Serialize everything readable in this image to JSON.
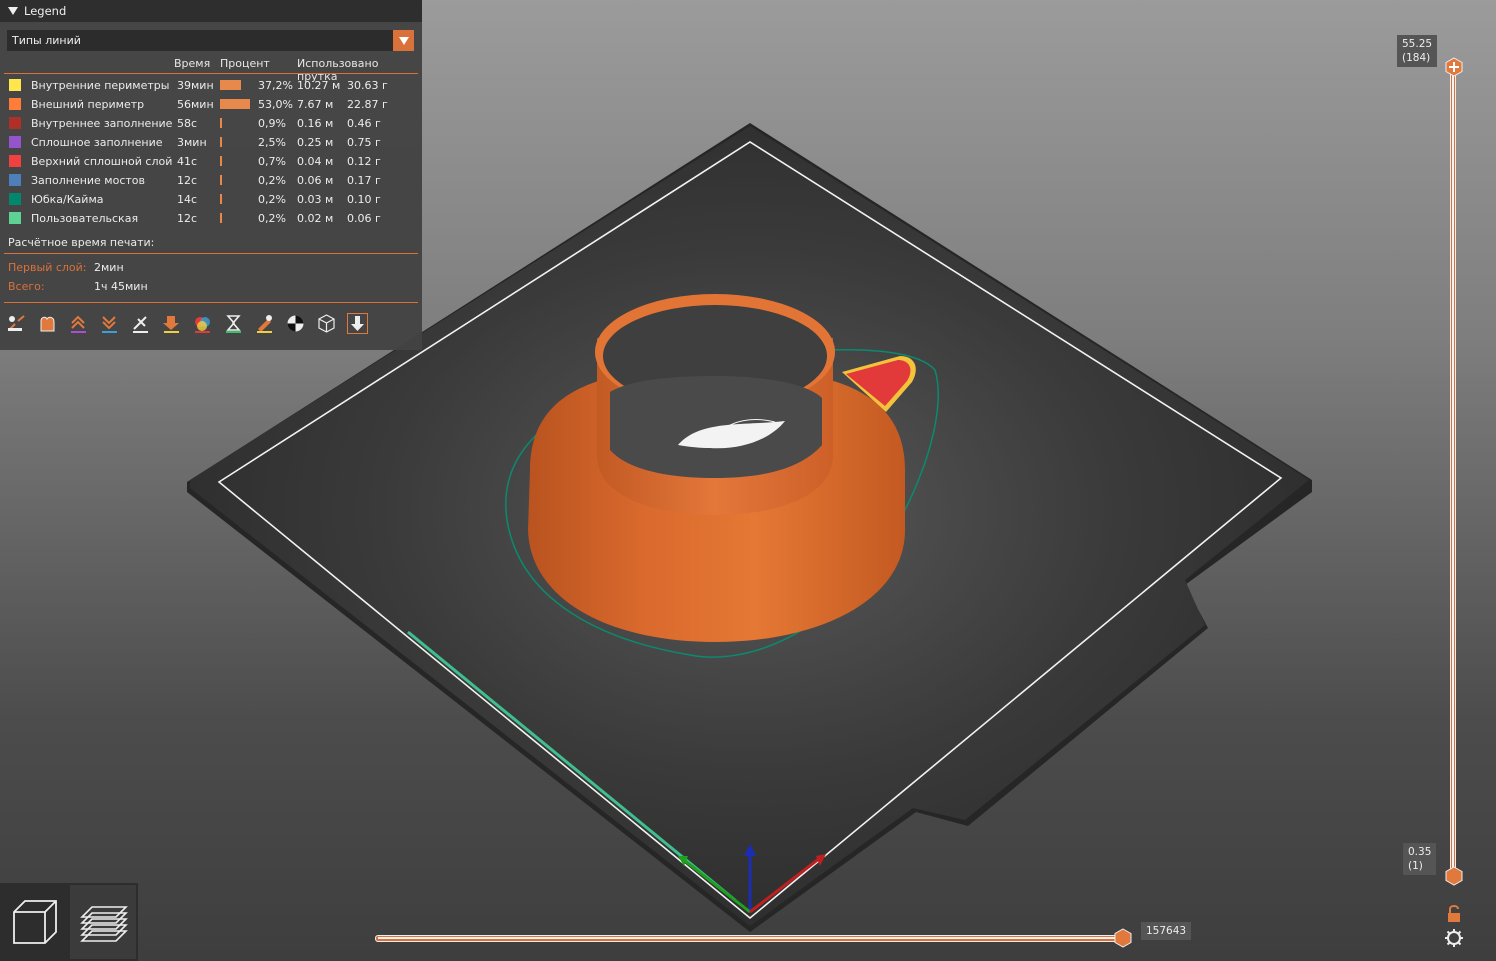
{
  "legend": {
    "title": "Legend",
    "view_type": "Типы линий",
    "columns": [
      "Время",
      "Процент",
      "Использовано прутка"
    ],
    "rows": [
      {
        "name": "Внутренние периметры",
        "color": "#ffe64d",
        "time": "39мин",
        "percent": "37,2%",
        "percent_value": 37.2,
        "length": "10.27 м",
        "weight": "30.63 г"
      },
      {
        "name": "Внешний периметр",
        "color": "#ff7d38",
        "time": "56мин",
        "percent": "53,0%",
        "percent_value": 53.0,
        "length": "7.67 м",
        "weight": "22.87 г"
      },
      {
        "name": "Внутреннее заполнение",
        "color": "#b03029",
        "time": "58с",
        "percent": "0,9%",
        "percent_value": 0.9,
        "length": "0.16 м",
        "weight": "0.46 г"
      },
      {
        "name": "Сплошное заполнение",
        "color": "#9654cc",
        "time": "3мин",
        "percent": "2,5%",
        "percent_value": 2.5,
        "length": "0.25 м",
        "weight": "0.75 г"
      },
      {
        "name": "Верхний сплошной слой",
        "color": "#f04040",
        "time": "41с",
        "percent": "0,7%",
        "percent_value": 0.7,
        "length": "0.04 м",
        "weight": "0.12 г"
      },
      {
        "name": "Заполнение мостов",
        "color": "#4d80ba",
        "time": "12с",
        "percent": "0,2%",
        "percent_value": 0.2,
        "length": "0.06 м",
        "weight": "0.17 г"
      },
      {
        "name": "Юбка/Кайма",
        "color": "#00876e",
        "time": "14с",
        "percent": "0,2%",
        "percent_value": 0.2,
        "length": "0.03 м",
        "weight": "0.10 г"
      },
      {
        "name": "Пользовательская",
        "color": "#5ed194",
        "time": "12с",
        "percent": "0,2%",
        "percent_value": 0.2,
        "length": "0.02 м",
        "weight": "0.06 г"
      }
    ],
    "estimated_time_label": "Расчётное время печати:",
    "first_layer_label": "Первый слой:",
    "first_layer_value": "2мин",
    "total_label": "Всего:",
    "total_value": "1ч 45мин",
    "toolbar_icons": [
      "travel-icon",
      "wipe-icon",
      "retractions-icon",
      "deretractions-icon",
      "seams-icon",
      "tool-changes-icon",
      "color-changes-icon",
      "pause-icon",
      "custom-gcode-icon",
      "center-of-gravity-icon",
      "shells-icon",
      "tool-marker-icon"
    ]
  },
  "vertical_slider": {
    "top_value": "55.25",
    "top_layer": "(184)",
    "bottom_value": "0.35",
    "bottom_layer": "(1)"
  },
  "horizontal_slider": {
    "value": "157643"
  },
  "accent_color": "#d9713a"
}
